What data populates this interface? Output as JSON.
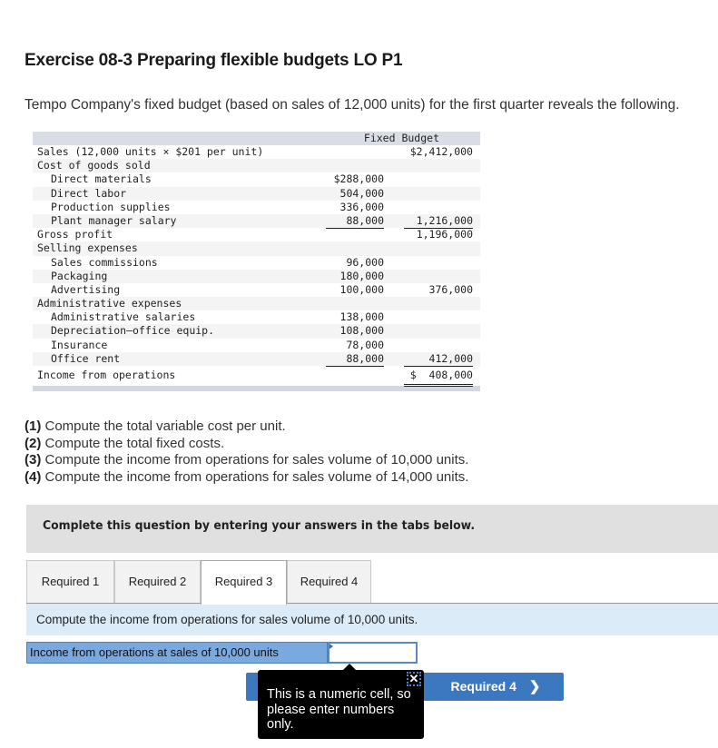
{
  "title": "Exercise 08-3 Preparing flexible budgets LO P1",
  "intro": "Tempo Company's fixed budget (based on sales of 12,000 units) for the first quarter reveals the following.",
  "budget": {
    "header": "Fixed Budget",
    "rows": [
      {
        "label": "Sales (12,000 units × $201 per unit)",
        "indent": false,
        "c1": "",
        "c2": "$2,412,000"
      },
      {
        "label": "Cost of goods sold",
        "indent": false,
        "c1": "",
        "c2": ""
      },
      {
        "label": "Direct materials",
        "indent": true,
        "c1": "$288,000",
        "c2": ""
      },
      {
        "label": "Direct labor",
        "indent": true,
        "c1": "504,000",
        "c2": ""
      },
      {
        "label": "Production supplies",
        "indent": true,
        "c1": "336,000",
        "c2": ""
      },
      {
        "label": "Plant manager salary",
        "indent": true,
        "c1": "88,000",
        "c2": "1,216,000"
      },
      {
        "label": "Gross profit",
        "indent": false,
        "c1": "",
        "c2": "1,196,000"
      },
      {
        "label": "Selling expenses",
        "indent": false,
        "c1": "",
        "c2": ""
      },
      {
        "label": "Sales commissions",
        "indent": true,
        "c1": "96,000",
        "c2": ""
      },
      {
        "label": "Packaging",
        "indent": true,
        "c1": "180,000",
        "c2": ""
      },
      {
        "label": "Advertising",
        "indent": true,
        "c1": "100,000",
        "c2": "376,000"
      },
      {
        "label": "Administrative expenses",
        "indent": false,
        "c1": "",
        "c2": ""
      },
      {
        "label": "Administrative salaries",
        "indent": true,
        "c1": "138,000",
        "c2": ""
      },
      {
        "label": "Depreciation—office equip.",
        "indent": true,
        "c1": "108,000",
        "c2": ""
      },
      {
        "label": "Insurance",
        "indent": true,
        "c1": "78,000",
        "c2": ""
      },
      {
        "label": "Office rent",
        "indent": true,
        "c1": "88,000",
        "c2": "412,000"
      },
      {
        "label": "Income from operations",
        "indent": false,
        "c1": "",
        "c2": "$  408,000"
      }
    ]
  },
  "requirements": [
    {
      "num": "(1)",
      "text": " Compute the total variable cost per unit."
    },
    {
      "num": "(2)",
      "text": " Compute the total fixed costs."
    },
    {
      "num": "(3)",
      "text": " Compute the income from operations for sales volume of 10,000 units."
    },
    {
      "num": "(4)",
      "text": " Compute the income from operations for sales volume of 14,000 units."
    }
  ],
  "banner": "Complete this question by entering your answers in the tabs below.",
  "tabs": [
    {
      "label": "Required 1",
      "active": false
    },
    {
      "label": "Required 2",
      "active": false
    },
    {
      "label": "Required 3",
      "active": true
    },
    {
      "label": "Required 4",
      "active": false
    }
  ],
  "question": "Compute the income from operations for sales volume of 10,000 units.",
  "answer": {
    "label": "Income from operations at sales of 10,000 units",
    "value": "",
    "placeholder": ""
  },
  "nav": {
    "next_label": "Required 4",
    "next_icon": "chevron-right-icon"
  },
  "tooltip": {
    "text": "This is a numeric cell, so please enter numbers only.",
    "close_icon": "close-icon",
    "close_glyph": "✕"
  },
  "colors": {
    "accent_blue": "#3b78c0",
    "answer_label_bg": "#7aa9e0",
    "question_strip_bg": "#dcebf8",
    "banner_bg": "#e0e0e0",
    "table_header_bg": "#d9dde6"
  }
}
